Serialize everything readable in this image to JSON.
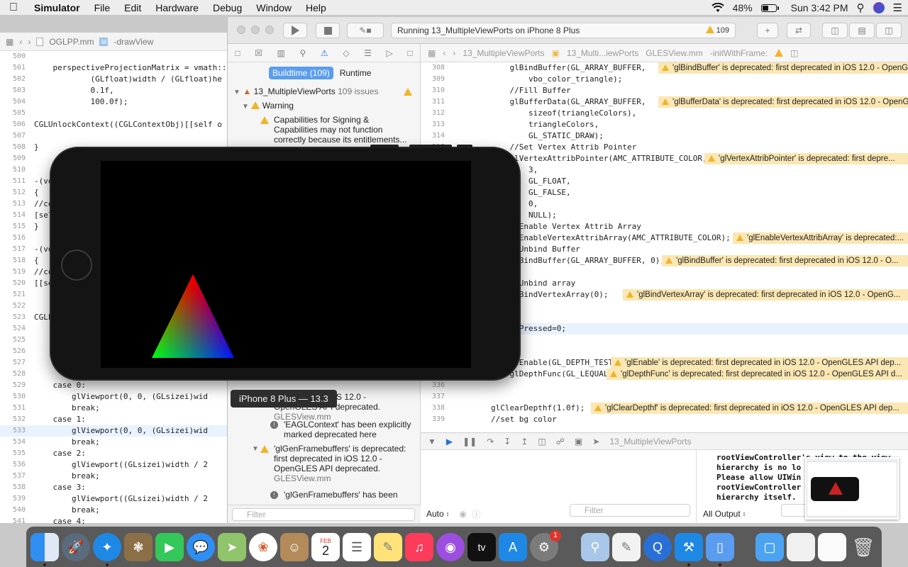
{
  "menubar": {
    "app_name": "Simulator",
    "menus": [
      "File",
      "Edit",
      "Hardware",
      "Debug",
      "Window",
      "Help"
    ],
    "battery": "48%",
    "battery_level": 0.48,
    "clock": "Sun 3:42 PM"
  },
  "left_editor": {
    "file": "OGLPP.mm",
    "method": "-drawView",
    "lines": [
      {
        "n": "500",
        "t": ""
      },
      {
        "n": "501",
        "t": "    perspectiveProjectionMatrix = vmath::"
      },
      {
        "n": "502",
        "t": "            (GLfloat)width / (GLfloat)he"
      },
      {
        "n": "503",
        "t": "            0.1f,"
      },
      {
        "n": "504",
        "t": "            100.0f);"
      },
      {
        "n": "505",
        "t": ""
      },
      {
        "n": "506",
        "t": "CGLUnlockContext((CGLContextObj)[[self o"
      },
      {
        "n": "507",
        "t": ""
      },
      {
        "n": "508",
        "t": "}"
      },
      {
        "n": "509",
        "t": ""
      },
      {
        "n": "510",
        "t": ""
      },
      {
        "n": "511",
        "t": "-(vo"
      },
      {
        "n": "512",
        "t": "{"
      },
      {
        "n": "513",
        "t": "//co"
      },
      {
        "n": "514",
        "t": "[sel"
      },
      {
        "n": "515",
        "t": "}"
      },
      {
        "n": "516",
        "t": ""
      },
      {
        "n": "517",
        "t": "-(vo"
      },
      {
        "n": "518",
        "t": "{"
      },
      {
        "n": "519",
        "t": "//co"
      },
      {
        "n": "520",
        "t": "[[se"
      },
      {
        "n": "521",
        "t": ""
      },
      {
        "n": "522",
        "t": ""
      },
      {
        "n": "523",
        "t": "CGLL"
      },
      {
        "n": "524",
        "t": ""
      },
      {
        "n": "525",
        "t": ""
      },
      {
        "n": "526",
        "t": ""
      },
      {
        "n": "527",
        "t": ""
      },
      {
        "n": "528",
        "t": ""
      },
      {
        "n": "529",
        "t": "    case 0:"
      },
      {
        "n": "530",
        "t": "        glViewport(0, 0, (GLsizei)wid"
      },
      {
        "n": "531",
        "t": "        break;"
      },
      {
        "n": "532",
        "t": "    case 1:"
      },
      {
        "n": "533",
        "t": "        glViewport(0, 0, (GLsizei)wid"
      },
      {
        "n": "534",
        "t": "        break;"
      },
      {
        "n": "535",
        "t": "    case 2:"
      },
      {
        "n": "536",
        "t": "        glViewport((GLsizei)width / 2"
      },
      {
        "n": "537",
        "t": "        break;"
      },
      {
        "n": "538",
        "t": "    case 3:"
      },
      {
        "n": "539",
        "t": "        glViewport((GLsizei)width / 2"
      },
      {
        "n": "540",
        "t": "        break;"
      },
      {
        "n": "541",
        "t": "    case 4:"
      }
    ]
  },
  "xcode": {
    "status": "Running 13_MultipleViewPorts on iPhone 8 Plus",
    "warning_count": "109",
    "nav": {
      "tab_buildtime": "Buildtime (109)",
      "tab_runtime": "Runtime",
      "project": "13_MultipleViewPorts",
      "project_issues": "109 issues",
      "group": "Warning",
      "issue1": "Capabilities for Signing & Capabilities may not function correctly because its entitlements...",
      "issue2_frag": "deprecated in iOS 12.0 - OpenGLES API deprecated. (Define GLES_SILE...",
      "issue2_file": "GLESView.mm",
      "issue3": "'EAGLContext' has been explicitly marked deprecated here",
      "issue4": "'glGenFramebuffers' is deprecated: first deprecated in iOS 12.0 - OpenGLES API deprecated. (Define...",
      "issue4_file": "GLESView.mm",
      "issue5": "'glGenFramebuffers' has been",
      "filter": "Filter"
    },
    "editor": {
      "crumbs": [
        "13_MultipleViewPorts",
        "13_Multi...iewPorts",
        "GLESView.mm",
        "-initWithFrame:"
      ],
      "lines": [
        {
          "n": "308",
          "t": "            glBindBuffer(GL_ARRAY_BUFFER,",
          "w": "'glBindBuffer' is deprecated: first deprecated in iOS 12.0 - OpenG..."
        },
        {
          "n": "309",
          "t": "                vbo_color_triangle);",
          "w": ""
        },
        {
          "n": "310",
          "t": "            //Fill Buffer",
          "w": ""
        },
        {
          "n": "311",
          "t": "            glBufferData(GL_ARRAY_BUFFER,",
          "w": "'glBufferData' is deprecated: first deprecated in iOS 12.0 - OpenG..."
        },
        {
          "n": "312",
          "t": "                sizeof(triangleColors),",
          "w": ""
        },
        {
          "n": "313",
          "t": "                triangleColors,",
          "w": ""
        },
        {
          "n": "314",
          "t": "                GL_STATIC_DRAW);",
          "w": ""
        },
        {
          "n": "315",
          "t": "            //Set Vertex Attrib Pointer",
          "w": ""
        },
        {
          "n": "316",
          "t": "            glVertexAttribPointer(AMC_ATTRIBUTE_COLOR,",
          "w": "'glVertexAttribPointer' is deprecated: first depre..."
        },
        {
          "n": "317",
          "t": "                3,",
          "w": ""
        },
        {
          "n": "318",
          "t": "                GL_FLOAT,",
          "w": ""
        },
        {
          "n": "319",
          "t": "                GL_FALSE,",
          "w": ""
        },
        {
          "n": "320",
          "t": "                0,",
          "w": ""
        },
        {
          "n": "321",
          "t": "                NULL);",
          "w": ""
        },
        {
          "n": "322",
          "t": "            //Enable Vertex Attrib Array",
          "w": ""
        },
        {
          "n": "323",
          "t": "            glEnableVertexAttribArray(AMC_ATTRIBUTE_COLOR);",
          "w": "'glEnableVertexAttribArray' is deprecated:..."
        },
        {
          "n": "324",
          "t": "            //Unbind Buffer",
          "w": ""
        },
        {
          "n": "325",
          "t": "            glBindBuffer(GL_ARRAY_BUFFER, 0);",
          "w": "'glBindBuffer' is deprecated: first deprecated in iOS 12.0 - O..."
        },
        {
          "n": "326",
          "t": "",
          "w": ""
        },
        {
          "n": "327",
          "t": "            //Unbind array",
          "w": ""
        },
        {
          "n": "328",
          "t": "            glBindVertexArray(0);",
          "w": "'glBindVertexArray' is deprecated: first deprecated in iOS 12.0 - OpenG..."
        },
        {
          "n": "329",
          "t": "",
          "w": ""
        },
        {
          "n": "330",
          "t": "",
          "w": ""
        },
        {
          "n": "331",
          "t": "            isPressed=0;",
          "w": ""
        },
        {
          "n": "332",
          "t": "",
          "w": ""
        },
        {
          "n": "333",
          "t": "",
          "w": ""
        },
        {
          "n": "334",
          "t": "            glEnable(GL_DEPTH_TEST);",
          "w": "'glEnable' is deprecated: first deprecated in iOS 12.0 - OpenGLES API dep..."
        },
        {
          "n": "335",
          "t": "            glDepthFunc(GL_LEQUAL);",
          "w": "'glDepthFunc' is deprecated: first deprecated in iOS 12.0 - OpenGLES API d..."
        },
        {
          "n": "336",
          "t": "",
          "w": ""
        },
        {
          "n": "337",
          "t": "",
          "w": ""
        },
        {
          "n": "338",
          "t": "        glClearDepthf(1.0f);",
          "w": "'glClearDepthf' is deprecated: first deprecated in iOS 12.0 - OpenGLES API dep..."
        },
        {
          "n": "339",
          "t": "        //set bg color",
          "w": ""
        }
      ]
    },
    "debug": {
      "target": "13_MultipleViewPorts",
      "auto": "Auto",
      "filter": "Filter",
      "output": "All Output",
      "console": "rootViewController's view to the view\nhierarchy is no lo\nPlease allow UIWin\nrootViewController\nhierarchy itself."
    }
  },
  "simulator": {
    "tooltip": "iPhone 8 Plus — 13.3"
  },
  "dock": {
    "calendar_month": "FEB",
    "calendar_day": "2",
    "appletv": "tv",
    "badge": "1"
  }
}
